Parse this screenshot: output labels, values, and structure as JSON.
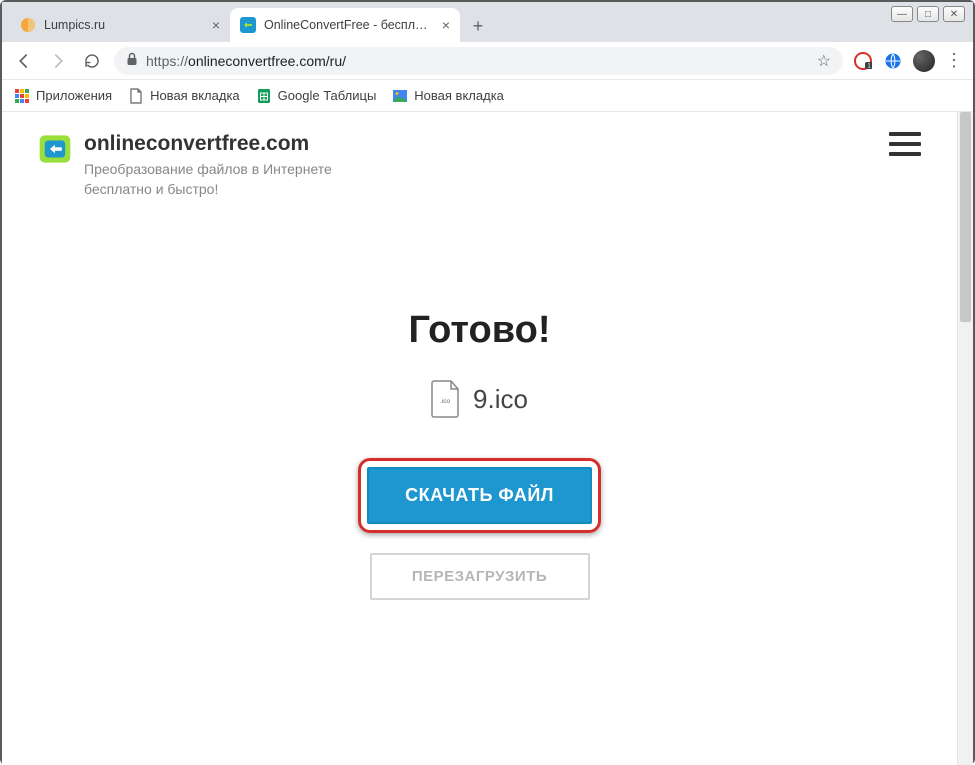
{
  "window": {
    "min_icon": "—",
    "max_icon": "□",
    "close_icon": "✕"
  },
  "tabs": {
    "inactive": {
      "title": "Lumpics.ru"
    },
    "active": {
      "title": "OnlineConvertFree - бесплатный"
    },
    "close_glyph": "×",
    "plus_glyph": "+"
  },
  "toolbar": {
    "url_proto": "https://",
    "url_rest": "onlineconvertfree.com/ru/"
  },
  "bookmarks": {
    "apps": "Приложения",
    "new_tab_1": "Новая вкладка",
    "google_sheets": "Google Таблицы",
    "new_tab_2": "Новая вкладка"
  },
  "site": {
    "name": "onlineconvertfree.com",
    "slogan": "Преобразование файлов в Интернете бесплатно и быстро!"
  },
  "main": {
    "done": "Готово!",
    "filename": "9.ico",
    "ico_label": ".ico",
    "download_label": "СКАЧАТЬ ФАЙЛ",
    "reload_label": "ПЕРЕЗАГРУЗИТЬ"
  }
}
